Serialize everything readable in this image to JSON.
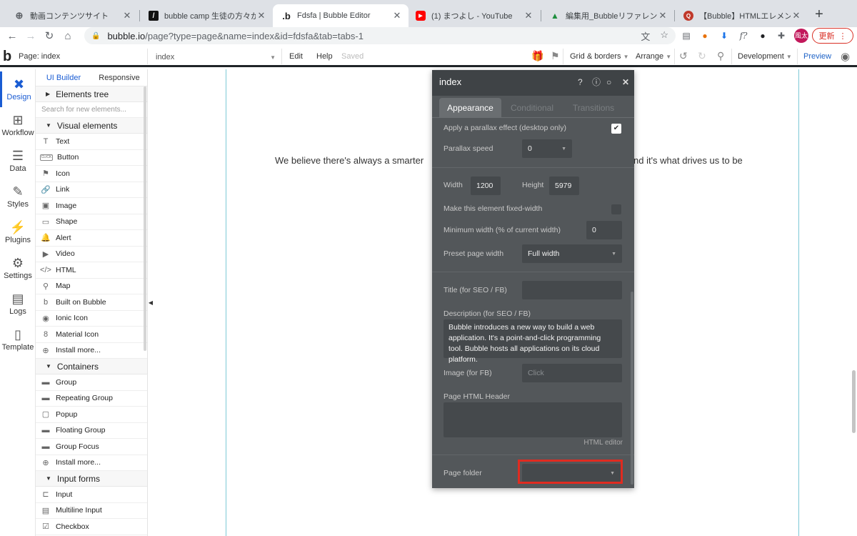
{
  "browser": {
    "tabs": [
      {
        "title": "動画コンテンツサイト",
        "icon": "globe-icon"
      },
      {
        "title": "bubble camp 生徒の方々からの",
        "icon": "notion-icon"
      },
      {
        "title": "Fdsfa | Bubble Editor",
        "icon": "bubble-icon"
      },
      {
        "title": "(1) まつよし - YouTube",
        "icon": "youtube-icon"
      },
      {
        "title": "編集用_Bubbleリファレンス翻",
        "icon": "drive-icon"
      },
      {
        "title": "【Bubble】HTMLエレメントで",
        "icon": "qiita-icon"
      }
    ],
    "url_host": "bubble.io",
    "url_path": "/page?type=page&name=index&id=fdsfa&tab=tabs-1",
    "profile_initials": "風太",
    "update_label": "更新",
    "accent": "#d93025"
  },
  "topbar": {
    "page_label": "Page: index",
    "page_dropdown": "index",
    "edit": "Edit",
    "help": "Help",
    "saved": "Saved",
    "grid": "Grid & borders",
    "arrange": "Arrange",
    "development": "Development",
    "preview": "Preview"
  },
  "rail": [
    {
      "label": "Design",
      "icon": "design-icon"
    },
    {
      "label": "Workflow",
      "icon": "workflow-icon"
    },
    {
      "label": "Data",
      "icon": "database-icon"
    },
    {
      "label": "Styles",
      "icon": "brush-icon"
    },
    {
      "label": "Plugins",
      "icon": "plug-icon"
    },
    {
      "label": "Settings",
      "icon": "gear-icon"
    },
    {
      "label": "Logs",
      "icon": "document-icon"
    },
    {
      "label": "Template",
      "icon": "template-icon"
    }
  ],
  "palette": {
    "tab_ui": "UI Builder",
    "tab_responsive": "Responsive",
    "elements_tree": "Elements tree",
    "search_placeholder": "Search for new elements...",
    "visual_header": "Visual elements",
    "visual": [
      {
        "label": "Text",
        "glyph": "T"
      },
      {
        "label": "Button",
        "glyph": "CLICK"
      },
      {
        "label": "Icon",
        "glyph": "⚑"
      },
      {
        "label": "Link",
        "glyph": "🔗"
      },
      {
        "label": "Image",
        "glyph": "▣"
      },
      {
        "label": "Shape",
        "glyph": "▭"
      },
      {
        "label": "Alert",
        "glyph": "🔔"
      },
      {
        "label": "Video",
        "glyph": "▶"
      },
      {
        "label": "HTML",
        "glyph": "</>"
      },
      {
        "label": "Map",
        "glyph": "⚲"
      },
      {
        "label": "Built on Bubble",
        "glyph": "b"
      },
      {
        "label": "Ionic Icon",
        "glyph": "◉"
      },
      {
        "label": "Material Icon",
        "glyph": "8"
      },
      {
        "label": "Install more...",
        "glyph": "⊕"
      }
    ],
    "containers_header": "Containers",
    "containers": [
      {
        "label": "Group",
        "glyph": "▬"
      },
      {
        "label": "Repeating Group",
        "glyph": "▬"
      },
      {
        "label": "Popup",
        "glyph": "▢"
      },
      {
        "label": "Floating Group",
        "glyph": "▬"
      },
      {
        "label": "Group Focus",
        "glyph": "▬"
      },
      {
        "label": "Install more...",
        "glyph": "⊕"
      }
    ],
    "inputs_header": "Input forms",
    "inputs": [
      {
        "label": "Input",
        "glyph": "⊏"
      },
      {
        "label": "Multiline Input",
        "glyph": "▤"
      },
      {
        "label": "Checkbox",
        "glyph": "☑"
      }
    ]
  },
  "canvas": {
    "tagline_left": "We believe there's always a smarter",
    "tagline_right": "nd it's what drives us to be"
  },
  "properties": {
    "title": "index",
    "tabs": [
      "Appearance",
      "Conditional",
      "Transitions"
    ],
    "parallax_label": "Apply a parallax effect (desktop only)",
    "parallax_speed_label": "Parallax speed",
    "parallax_speed": "0",
    "width_label": "Width",
    "width": "1200",
    "height_label": "Height",
    "height": "5979",
    "fixed_width_label": "Make this element fixed-width",
    "min_width_label": "Minimum width (% of current width)",
    "min_width": "0",
    "preset_label": "Preset page width",
    "preset": "Full width",
    "seo_title_label": "Title (for SEO / FB)",
    "seo_desc_label": "Description (for SEO / FB)",
    "seo_desc": "Bubble introduces a new way to build a web application. It's a point-and-click programming tool. Bubble hosts all applications on its cloud platform.",
    "image_label": "Image (for FB)",
    "image_placeholder": "Click",
    "html_header_label": "Page HTML Header",
    "html_editor": "HTML editor",
    "folder_label": "Page folder"
  }
}
